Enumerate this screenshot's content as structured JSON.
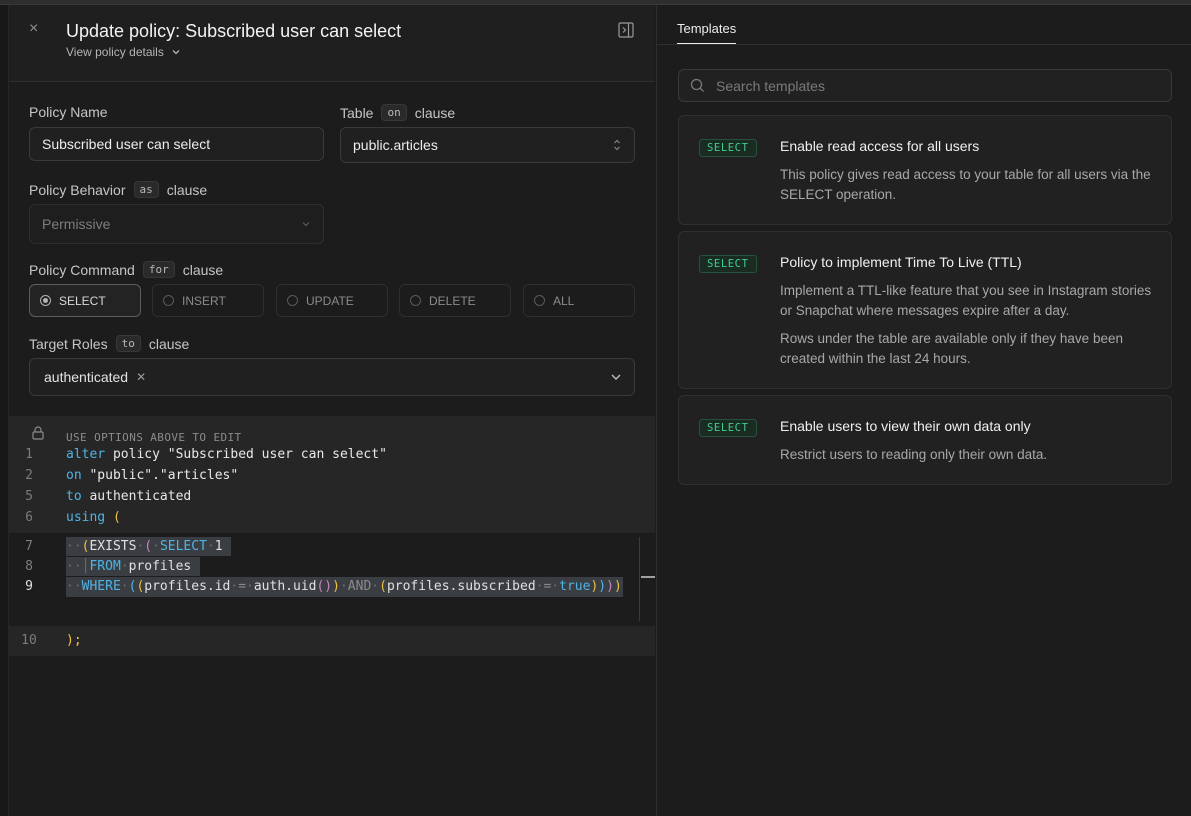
{
  "header": {
    "title": "Update policy: Subscribed user can select",
    "view_details": "View policy details"
  },
  "form": {
    "policy_name_label": "Policy Name",
    "policy_name_value": "Subscribed user can select",
    "table_label": "Table",
    "table_kbd": "on",
    "table_clause": "clause",
    "table_value": "public.articles",
    "behavior_label": "Policy Behavior",
    "behavior_kbd": "as",
    "behavior_clause": "clause",
    "behavior_value": "Permissive",
    "command_label": "Policy Command",
    "command_kbd": "for",
    "command_clause": "clause",
    "commands": [
      "SELECT",
      "INSERT",
      "UPDATE",
      "DELETE",
      "ALL"
    ],
    "selected_command": "SELECT",
    "roles_label": "Target Roles",
    "roles_kbd": "to",
    "roles_clause": "clause",
    "roles": [
      "authenticated"
    ]
  },
  "editor": {
    "readonly_note": "USE OPTIONS ABOVE TO EDIT",
    "line_numbers": [
      "1",
      "2",
      "5",
      "6",
      "7",
      "8",
      "9",
      "10"
    ],
    "lines": {
      "l1_kw": "alter",
      "l1_rest": " policy \"Subscribed user can select\"",
      "l2_kw": "on",
      "l2_rest": " \"public\".\"articles\"",
      "l5_kw": "to",
      "l5_rest": " authenticated",
      "l6_kw": "using",
      "l6_paren": " (",
      "l10": ");"
    }
  },
  "templates": {
    "tab_label": "Templates",
    "search_placeholder": "Search templates",
    "items": [
      {
        "badge": "SELECT",
        "title": "Enable read access for all users",
        "desc": [
          "This policy gives read access to your table for all users via the SELECT operation."
        ]
      },
      {
        "badge": "SELECT",
        "title": "Policy to implement Time To Live (TTL)",
        "desc": [
          "Implement a TTL-like feature that you see in Instagram stories or Snapchat where messages expire after a day.",
          "Rows under the table are available only if they have been created within the last 24 hours."
        ]
      },
      {
        "badge": "SELECT",
        "title": "Enable users to view their own data only",
        "desc": [
          "Restrict users to reading only their own data."
        ]
      }
    ]
  },
  "colors": {
    "background": "#1c1c1c",
    "accent_green": "#3ecf8e",
    "keyword_blue": "#4fb4e6",
    "paren_yellow": "#f0c040"
  }
}
